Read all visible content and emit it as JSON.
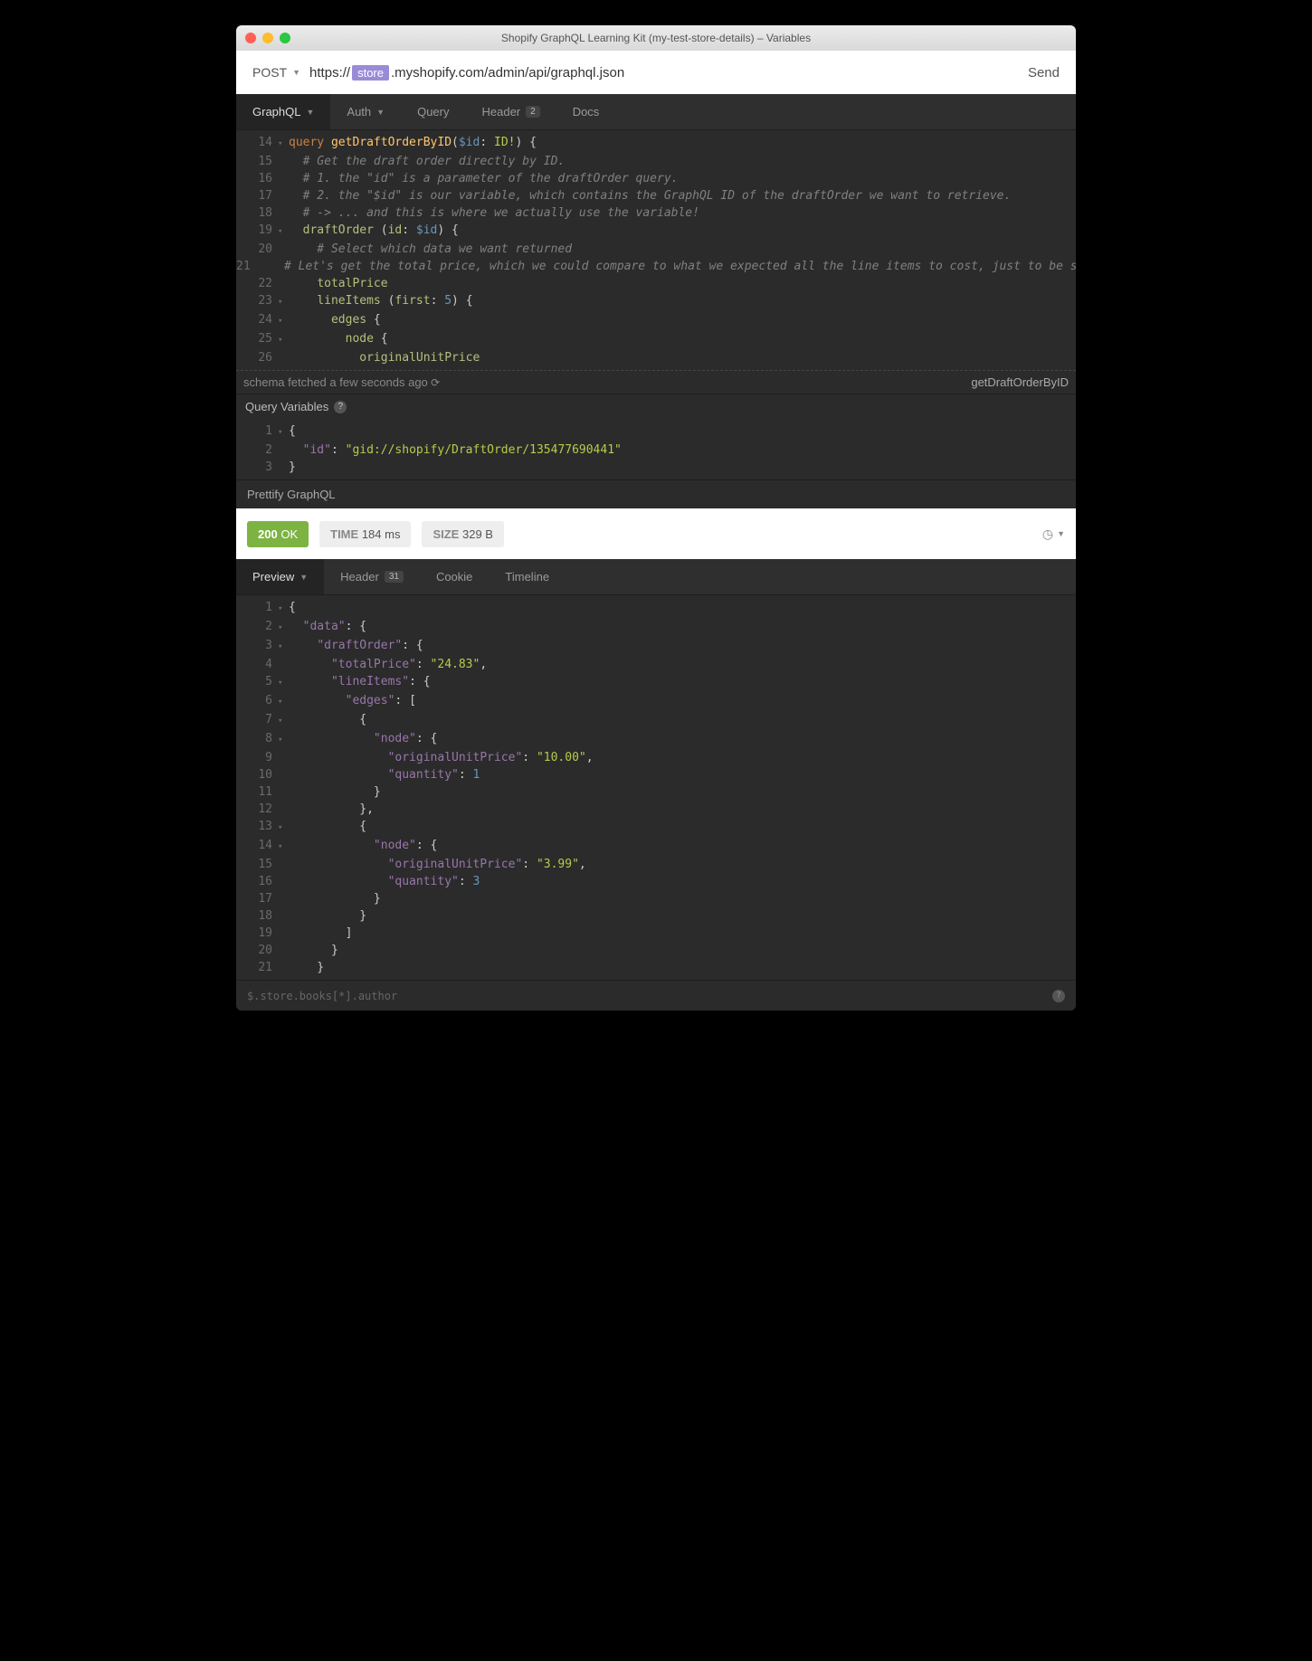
{
  "window": {
    "title": "Shopify GraphQL Learning Kit (my-test-store-details) – Variables"
  },
  "request": {
    "method": "POST",
    "url_prefix": "https://",
    "url_tag": "store",
    "url_suffix": ".myshopify.com/admin/api/graphql.json",
    "send": "Send"
  },
  "reqTabs": {
    "graphql": "GraphQL",
    "auth": "Auth",
    "query": "Query",
    "header": "Header",
    "header_badge": "2",
    "docs": "Docs"
  },
  "queryEditor": {
    "lines": [
      {
        "n": 14,
        "fold": "▾",
        "tokens": [
          [
            "kw",
            "query "
          ],
          [
            "fn",
            "getDraftOrderByID"
          ],
          [
            "punct",
            "("
          ],
          [
            "var",
            "$id"
          ],
          [
            "punct",
            ": "
          ],
          [
            "type",
            "ID!"
          ],
          [
            "punct",
            ") {"
          ]
        ]
      },
      {
        "n": 15,
        "fold": "",
        "tokens": [
          [
            "cmt",
            "  # Get the draft order directly by ID."
          ]
        ]
      },
      {
        "n": 16,
        "fold": "",
        "tokens": [
          [
            "cmt",
            "  # 1. the \"id\" is a parameter of the draftOrder query."
          ]
        ]
      },
      {
        "n": 17,
        "fold": "",
        "tokens": [
          [
            "cmt",
            "  # 2. the \"$id\" is our variable, which contains the GraphQL ID of the draftOrder we want to retrieve."
          ]
        ]
      },
      {
        "n": 18,
        "fold": "",
        "tokens": [
          [
            "cmt",
            "  # -> ... and this is where we actually use the variable!"
          ]
        ]
      },
      {
        "n": 19,
        "fold": "▾",
        "tokens": [
          [
            "punct",
            "  "
          ],
          [
            "fieldname",
            "draftOrder"
          ],
          [
            "punct",
            " ("
          ],
          [
            "fieldname",
            "id"
          ],
          [
            "punct",
            ": "
          ],
          [
            "var",
            "$id"
          ],
          [
            "punct",
            ") {"
          ]
        ]
      },
      {
        "n": 20,
        "fold": "",
        "tokens": [
          [
            "cmt",
            "    # Select which data we want returned"
          ]
        ]
      },
      {
        "n": 21,
        "fold": "",
        "tokens": [
          [
            "cmt",
            "    # Let's get the total price, which we could compare to what we expected all the line items to cost, just to be sure."
          ]
        ]
      },
      {
        "n": 22,
        "fold": "",
        "tokens": [
          [
            "punct",
            "    "
          ],
          [
            "fieldname",
            "totalPrice"
          ]
        ]
      },
      {
        "n": 23,
        "fold": "▾",
        "tokens": [
          [
            "punct",
            "    "
          ],
          [
            "fieldname",
            "lineItems"
          ],
          [
            "punct",
            " ("
          ],
          [
            "fieldname",
            "first"
          ],
          [
            "punct",
            ": "
          ],
          [
            "num",
            "5"
          ],
          [
            "punct",
            ") {"
          ]
        ]
      },
      {
        "n": 24,
        "fold": "▾",
        "tokens": [
          [
            "punct",
            "      "
          ],
          [
            "fieldname",
            "edges"
          ],
          [
            "punct",
            " {"
          ]
        ]
      },
      {
        "n": 25,
        "fold": "▾",
        "tokens": [
          [
            "punct",
            "        "
          ],
          [
            "fieldname",
            "node"
          ],
          [
            "punct",
            " {"
          ]
        ]
      },
      {
        "n": 26,
        "fold": "",
        "tokens": [
          [
            "punct",
            "          "
          ],
          [
            "fieldname",
            "originalUnitPrice"
          ]
        ]
      }
    ]
  },
  "schema": {
    "left": "schema fetched a few seconds ago",
    "right": "getDraftOrderByID"
  },
  "varSection": {
    "title": "Query Variables"
  },
  "varEditor": {
    "lines": [
      {
        "n": 1,
        "fold": "▾",
        "tokens": [
          [
            "punct",
            "{"
          ]
        ]
      },
      {
        "n": 2,
        "fold": "",
        "tokens": [
          [
            "punct",
            "  "
          ],
          [
            "key",
            "\"id\""
          ],
          [
            "punct",
            ": "
          ],
          [
            "str",
            "\"gid://shopify/DraftOrder/135477690441\""
          ]
        ]
      },
      {
        "n": 3,
        "fold": "",
        "tokens": [
          [
            "punct",
            "}"
          ]
        ]
      }
    ]
  },
  "prettify": "Prettify GraphQL",
  "status": {
    "code": "200",
    "code_text": "OK",
    "time_label": "TIME",
    "time_val": "184 ms",
    "size_label": "SIZE",
    "size_val": "329 B"
  },
  "respTabs": {
    "preview": "Preview",
    "header": "Header",
    "header_badge": "31",
    "cookie": "Cookie",
    "timeline": "Timeline"
  },
  "respEditor": {
    "lines": [
      {
        "n": 1,
        "fold": "▾",
        "tokens": [
          [
            "punct",
            "{"
          ]
        ]
      },
      {
        "n": 2,
        "fold": "▾",
        "tokens": [
          [
            "punct",
            "  "
          ],
          [
            "key",
            "\"data\""
          ],
          [
            "punct",
            ": {"
          ]
        ]
      },
      {
        "n": 3,
        "fold": "▾",
        "tokens": [
          [
            "punct",
            "    "
          ],
          [
            "key",
            "\"draftOrder\""
          ],
          [
            "punct",
            ": {"
          ]
        ]
      },
      {
        "n": 4,
        "fold": "",
        "tokens": [
          [
            "punct",
            "      "
          ],
          [
            "key",
            "\"totalPrice\""
          ],
          [
            "punct",
            ": "
          ],
          [
            "str",
            "\"24.83\""
          ],
          [
            "punct",
            ","
          ]
        ]
      },
      {
        "n": 5,
        "fold": "▾",
        "tokens": [
          [
            "punct",
            "      "
          ],
          [
            "key",
            "\"lineItems\""
          ],
          [
            "punct",
            ": {"
          ]
        ]
      },
      {
        "n": 6,
        "fold": "▾",
        "tokens": [
          [
            "punct",
            "        "
          ],
          [
            "key",
            "\"edges\""
          ],
          [
            "punct",
            ": ["
          ]
        ]
      },
      {
        "n": 7,
        "fold": "▾",
        "tokens": [
          [
            "punct",
            "          {"
          ]
        ]
      },
      {
        "n": 8,
        "fold": "▾",
        "tokens": [
          [
            "punct",
            "            "
          ],
          [
            "key",
            "\"node\""
          ],
          [
            "punct",
            ": {"
          ]
        ]
      },
      {
        "n": 9,
        "fold": "",
        "tokens": [
          [
            "punct",
            "              "
          ],
          [
            "key",
            "\"originalUnitPrice\""
          ],
          [
            "punct",
            ": "
          ],
          [
            "str",
            "\"10.00\""
          ],
          [
            "punct",
            ","
          ]
        ]
      },
      {
        "n": 10,
        "fold": "",
        "tokens": [
          [
            "punct",
            "              "
          ],
          [
            "key",
            "\"quantity\""
          ],
          [
            "punct",
            ": "
          ],
          [
            "num",
            "1"
          ]
        ]
      },
      {
        "n": 11,
        "fold": "",
        "tokens": [
          [
            "punct",
            "            }"
          ]
        ]
      },
      {
        "n": 12,
        "fold": "",
        "tokens": [
          [
            "punct",
            "          },"
          ]
        ]
      },
      {
        "n": 13,
        "fold": "▾",
        "tokens": [
          [
            "punct",
            "          {"
          ]
        ]
      },
      {
        "n": 14,
        "fold": "▾",
        "tokens": [
          [
            "punct",
            "            "
          ],
          [
            "key",
            "\"node\""
          ],
          [
            "punct",
            ": {"
          ]
        ]
      },
      {
        "n": 15,
        "fold": "",
        "tokens": [
          [
            "punct",
            "              "
          ],
          [
            "key",
            "\"originalUnitPrice\""
          ],
          [
            "punct",
            ": "
          ],
          [
            "str",
            "\"3.99\""
          ],
          [
            "punct",
            ","
          ]
        ]
      },
      {
        "n": 16,
        "fold": "",
        "tokens": [
          [
            "punct",
            "              "
          ],
          [
            "key",
            "\"quantity\""
          ],
          [
            "punct",
            ": "
          ],
          [
            "num",
            "3"
          ]
        ]
      },
      {
        "n": 17,
        "fold": "",
        "tokens": [
          [
            "punct",
            "            }"
          ]
        ]
      },
      {
        "n": 18,
        "fold": "",
        "tokens": [
          [
            "punct",
            "          }"
          ]
        ]
      },
      {
        "n": 19,
        "fold": "",
        "tokens": [
          [
            "punct",
            "        ]"
          ]
        ]
      },
      {
        "n": 20,
        "fold": "",
        "tokens": [
          [
            "punct",
            "      }"
          ]
        ]
      },
      {
        "n": 21,
        "fold": "",
        "tokens": [
          [
            "punct",
            "    }"
          ]
        ]
      }
    ]
  },
  "jsonpath": {
    "placeholder": "$.store.books[*].author"
  }
}
